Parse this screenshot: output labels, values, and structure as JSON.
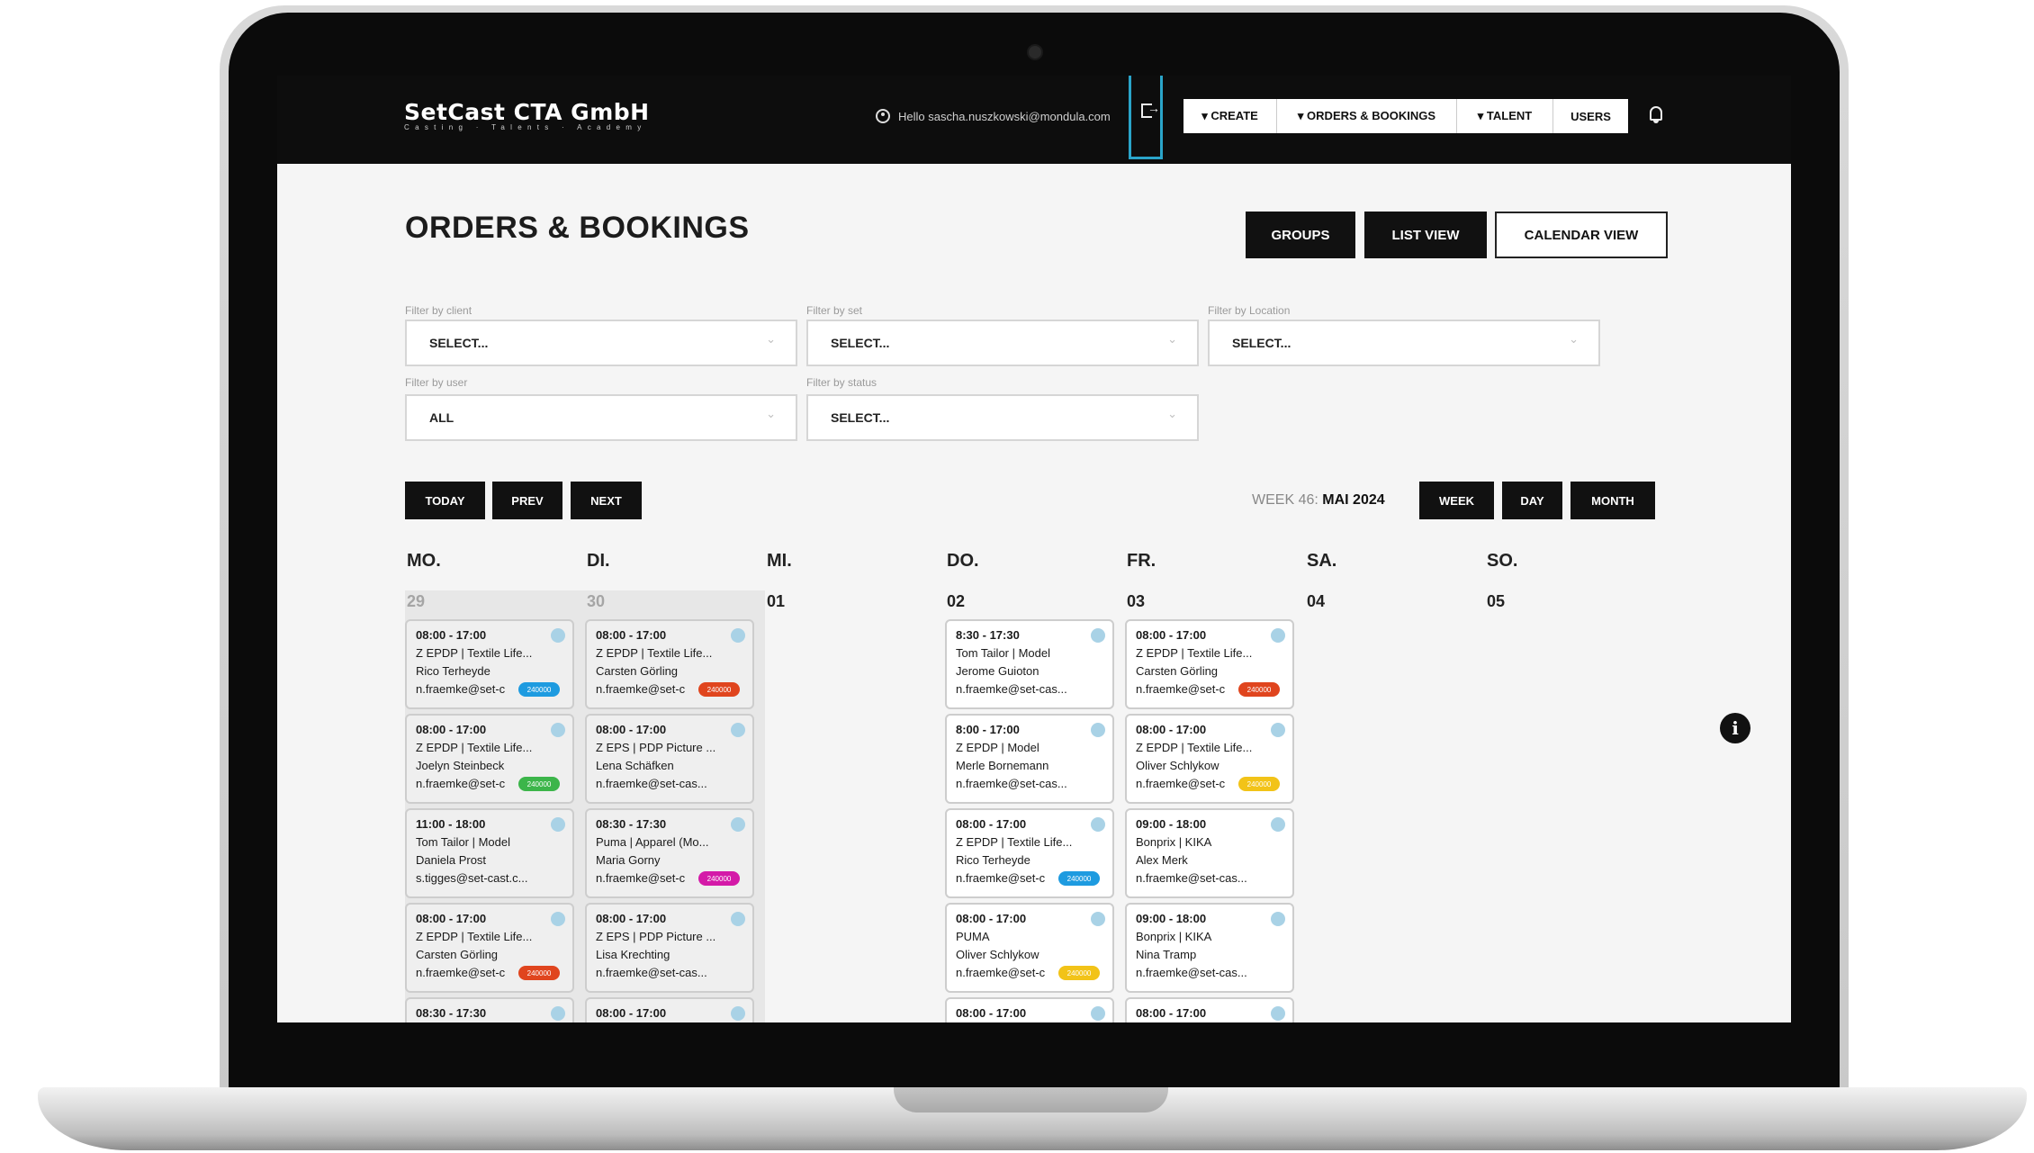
{
  "header": {
    "brand": "SetCast CTA GmbH",
    "brand_sub": "Casting · Talents · Academy",
    "greeting": "Hello sascha.nuszkowski@mondula.com",
    "nav": [
      {
        "label": "▾ CREATE"
      },
      {
        "label": "▾ ORDERS & BOOKINGS"
      },
      {
        "label": "▾ TALENT"
      },
      {
        "label": "USERS"
      }
    ]
  },
  "page": {
    "title": "ORDERS & BOOKINGS",
    "views": {
      "groups": "GROUPS",
      "list": "LIST VIEW",
      "calendar": "CALENDAR VIEW"
    }
  },
  "filters": {
    "client": {
      "label": "Filter by client",
      "value": "SELECT..."
    },
    "set": {
      "label": "Filter by set",
      "value": "SELECT..."
    },
    "location": {
      "label": "Filter by Location",
      "value": "SELECT..."
    },
    "user": {
      "label": "Filter by user",
      "value": "ALL"
    },
    "status": {
      "label": "Filter by status",
      "value": "SELECT..."
    }
  },
  "calendar_nav": {
    "today": "TODAY",
    "prev": "PREV",
    "next": "NEXT",
    "week_prefix": "WEEK 46:",
    "month": "MAI 2024",
    "week": "WEEK",
    "day": "DAY",
    "month_btn": "MONTH"
  },
  "days": [
    {
      "dow": "MO.",
      "num": "29"
    },
    {
      "dow": "DI.",
      "num": "30"
    },
    {
      "dow": "MI.",
      "num": "01"
    },
    {
      "dow": "DO.",
      "num": "02"
    },
    {
      "dow": "FR.",
      "num": "03"
    },
    {
      "dow": "SA.",
      "num": "04"
    },
    {
      "dow": "SO.",
      "num": "05"
    }
  ],
  "events": {
    "mo": [
      {
        "time": "08:00 - 17:00",
        "title": "Z EPDP | Textile Life...",
        "person": "Rico Terheyde",
        "email": "n.fraemke@set-c",
        "tag": "240000",
        "tag_color": "#1e9be0"
      },
      {
        "time": "08:00 - 17:00",
        "title": "Z EPDP | Textile Life...",
        "person": "Joelyn Steinbeck",
        "email": "n.fraemke@set-c",
        "tag": "240000",
        "tag_color": "#3cb54a"
      },
      {
        "time": "11:00 - 18:00",
        "title": "Tom Tailor | Model",
        "person": "Daniela Prost",
        "email": "s.tigges@set-cast.c...",
        "tag": "",
        "tag_color": ""
      },
      {
        "time": "08:00 - 17:00",
        "title": "Z EPDP | Textile Life...",
        "person": "Carsten Görling",
        "email": "n.fraemke@set-c",
        "tag": "240000",
        "tag_color": "#e0451e"
      },
      {
        "time": "08:30 - 17:30",
        "title": "",
        "person": "",
        "email": "",
        "tag": "",
        "tag_color": ""
      }
    ],
    "di": [
      {
        "time": "08:00 - 17:00",
        "title": "Z EPDP | Textile Life...",
        "person": "Carsten Görling",
        "email": "n.fraemke@set-c",
        "tag": "240000",
        "tag_color": "#e0451e"
      },
      {
        "time": "08:00 - 17:00",
        "title": "Z EPS | PDP Picture ...",
        "person": "Lena Schäfken",
        "email": "n.fraemke@set-cas...",
        "tag": "",
        "tag_color": ""
      },
      {
        "time": "08:30 - 17:30",
        "title": "Puma | Apparel (Mo...",
        "person": "Maria Gorny",
        "email": "n.fraemke@set-c",
        "tag": "240000",
        "tag_color": "#d41aa8"
      },
      {
        "time": "08:00 - 17:00",
        "title": "Z EPS | PDP Picture ...",
        "person": "Lisa Krechting",
        "email": "n.fraemke@set-cas...",
        "tag": "",
        "tag_color": ""
      },
      {
        "time": "08:00 - 17:00",
        "title": "",
        "person": "",
        "email": "",
        "tag": "",
        "tag_color": ""
      }
    ],
    "do": [
      {
        "time": "8:30 - 17:30",
        "title": "Tom Tailor | Model",
        "person": "Jerome Guioton",
        "email": "n.fraemke@set-cas...",
        "tag": "",
        "tag_color": ""
      },
      {
        "time": "8:00 - 17:00",
        "title": "Z EPDP | Model",
        "person": "Merle Bornemann",
        "email": "n.fraemke@set-cas...",
        "tag": "",
        "tag_color": ""
      },
      {
        "time": "08:00 - 17:00",
        "title": "Z EPDP | Textile Life...",
        "person": "Rico Terheyde",
        "email": "n.fraemke@set-c",
        "tag": "240000",
        "tag_color": "#1e9be0"
      },
      {
        "time": "08:00 - 17:00",
        "title": "PUMA",
        "person": "Oliver Schlykow",
        "email": "n.fraemke@set-c",
        "tag": "240000",
        "tag_color": "#f2c318"
      },
      {
        "time": "08:00 - 17:00",
        "title": "",
        "person": "",
        "email": "",
        "tag": "",
        "tag_color": ""
      }
    ],
    "fr": [
      {
        "time": "08:00 - 17:00",
        "title": "Z EPDP | Textile Life...",
        "person": "Carsten Görling",
        "email": "n.fraemke@set-c",
        "tag": "240000",
        "tag_color": "#e0451e"
      },
      {
        "time": "08:00 - 17:00",
        "title": "Z EPDP | Textile Life...",
        "person": "Oliver Schlykow",
        "email": "n.fraemke@set-c",
        "tag": "240000",
        "tag_color": "#f2c318"
      },
      {
        "time": "09:00 - 18:00",
        "title": "Bonprix | KIKA",
        "person": "Alex Merk",
        "email": "n.fraemke@set-cas...",
        "tag": "",
        "tag_color": ""
      },
      {
        "time": "09:00 - 18:00",
        "title": "Bonprix | KIKA",
        "person": "Nina Tramp",
        "email": "n.fraemke@set-cas...",
        "tag": "",
        "tag_color": ""
      },
      {
        "time": "08:00 - 17:00",
        "title": "",
        "person": "",
        "email": "",
        "tag": "",
        "tag_color": ""
      }
    ]
  }
}
